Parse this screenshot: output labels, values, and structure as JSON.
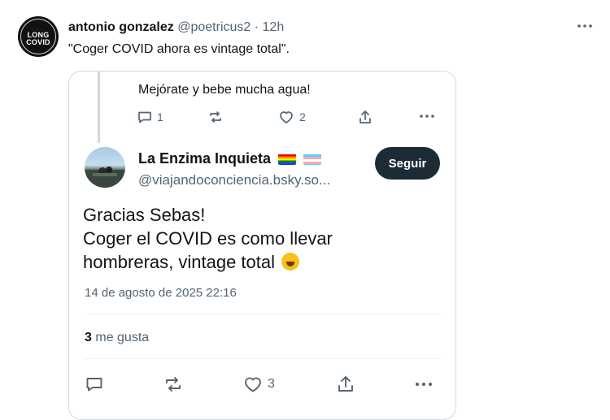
{
  "post": {
    "author_name": "antonio gonzalez",
    "meta": "@poetricus2 · 12h",
    "text": "\"Coger COVID ahora es vintage total\".",
    "avatar_line1": "LONG",
    "avatar_line2": "COVID",
    "more_icon": "ellipsis-icon"
  },
  "quoted_parent": {
    "text": "Mejórate y bebe mucha agua!",
    "actions": {
      "replies": "1",
      "likes": "2"
    }
  },
  "reply": {
    "author_name": "La Enzima Inquieta",
    "handle": "@viajandoconciencia.bsky.so...",
    "follow_label": "Seguir",
    "body_line1": "Gracias Sebas!",
    "body_line2": "Coger el COVID es como llevar",
    "body_line3": "hombreras, vintage total",
    "date": "14 de agosto de 2025 22:16",
    "likes_count": "3",
    "likes_label": "me gusta",
    "actions": {
      "likes": "3"
    }
  },
  "colors": {
    "accent_dark": "#1d2b34",
    "muted": "#536471",
    "border": "#cfd9de"
  }
}
